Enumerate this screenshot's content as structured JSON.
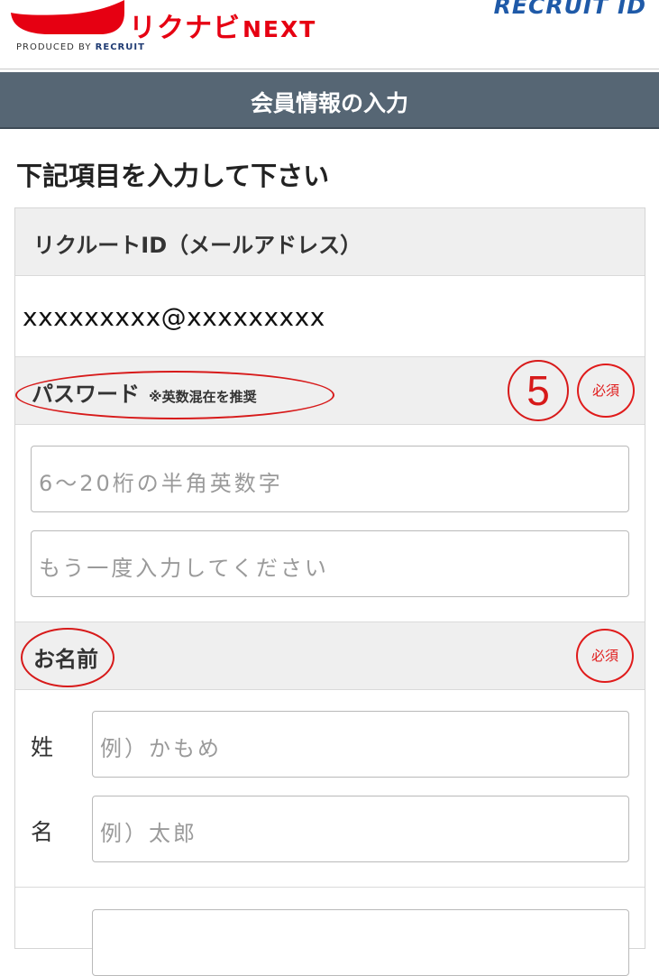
{
  "header": {
    "logo_text": "リクナビ",
    "logo_next": "NEXT",
    "produced_by": "PRODUCED BY",
    "produced_brand": "RECRUIT",
    "recruit_id": "RECRUIT ID"
  },
  "title_bar": "会員情報の入力",
  "instruction": "下記項目を入力して下さい",
  "sections": {
    "recruit_id": {
      "label": "リクルートID（メールアドレス）",
      "value": "xxxxxxxxx@xxxxxxxxx"
    },
    "password": {
      "label": "パスワード",
      "note": "※英数混在を推奨",
      "badge": "必須",
      "step": "5",
      "placeholder_1": "6〜20桁の半角英数字",
      "placeholder_2": "もう一度入力してください"
    },
    "name": {
      "label": "お名前",
      "badge": "必須",
      "last_label": "姓",
      "last_placeholder": "例）かもめ",
      "first_label": "名",
      "first_placeholder": "例）太郎"
    }
  },
  "colors": {
    "brand_red": "#e60012",
    "title_bar_bg": "#566674",
    "annotation_red": "#d71a1a",
    "recruit_blue": "#1f5aa8"
  }
}
